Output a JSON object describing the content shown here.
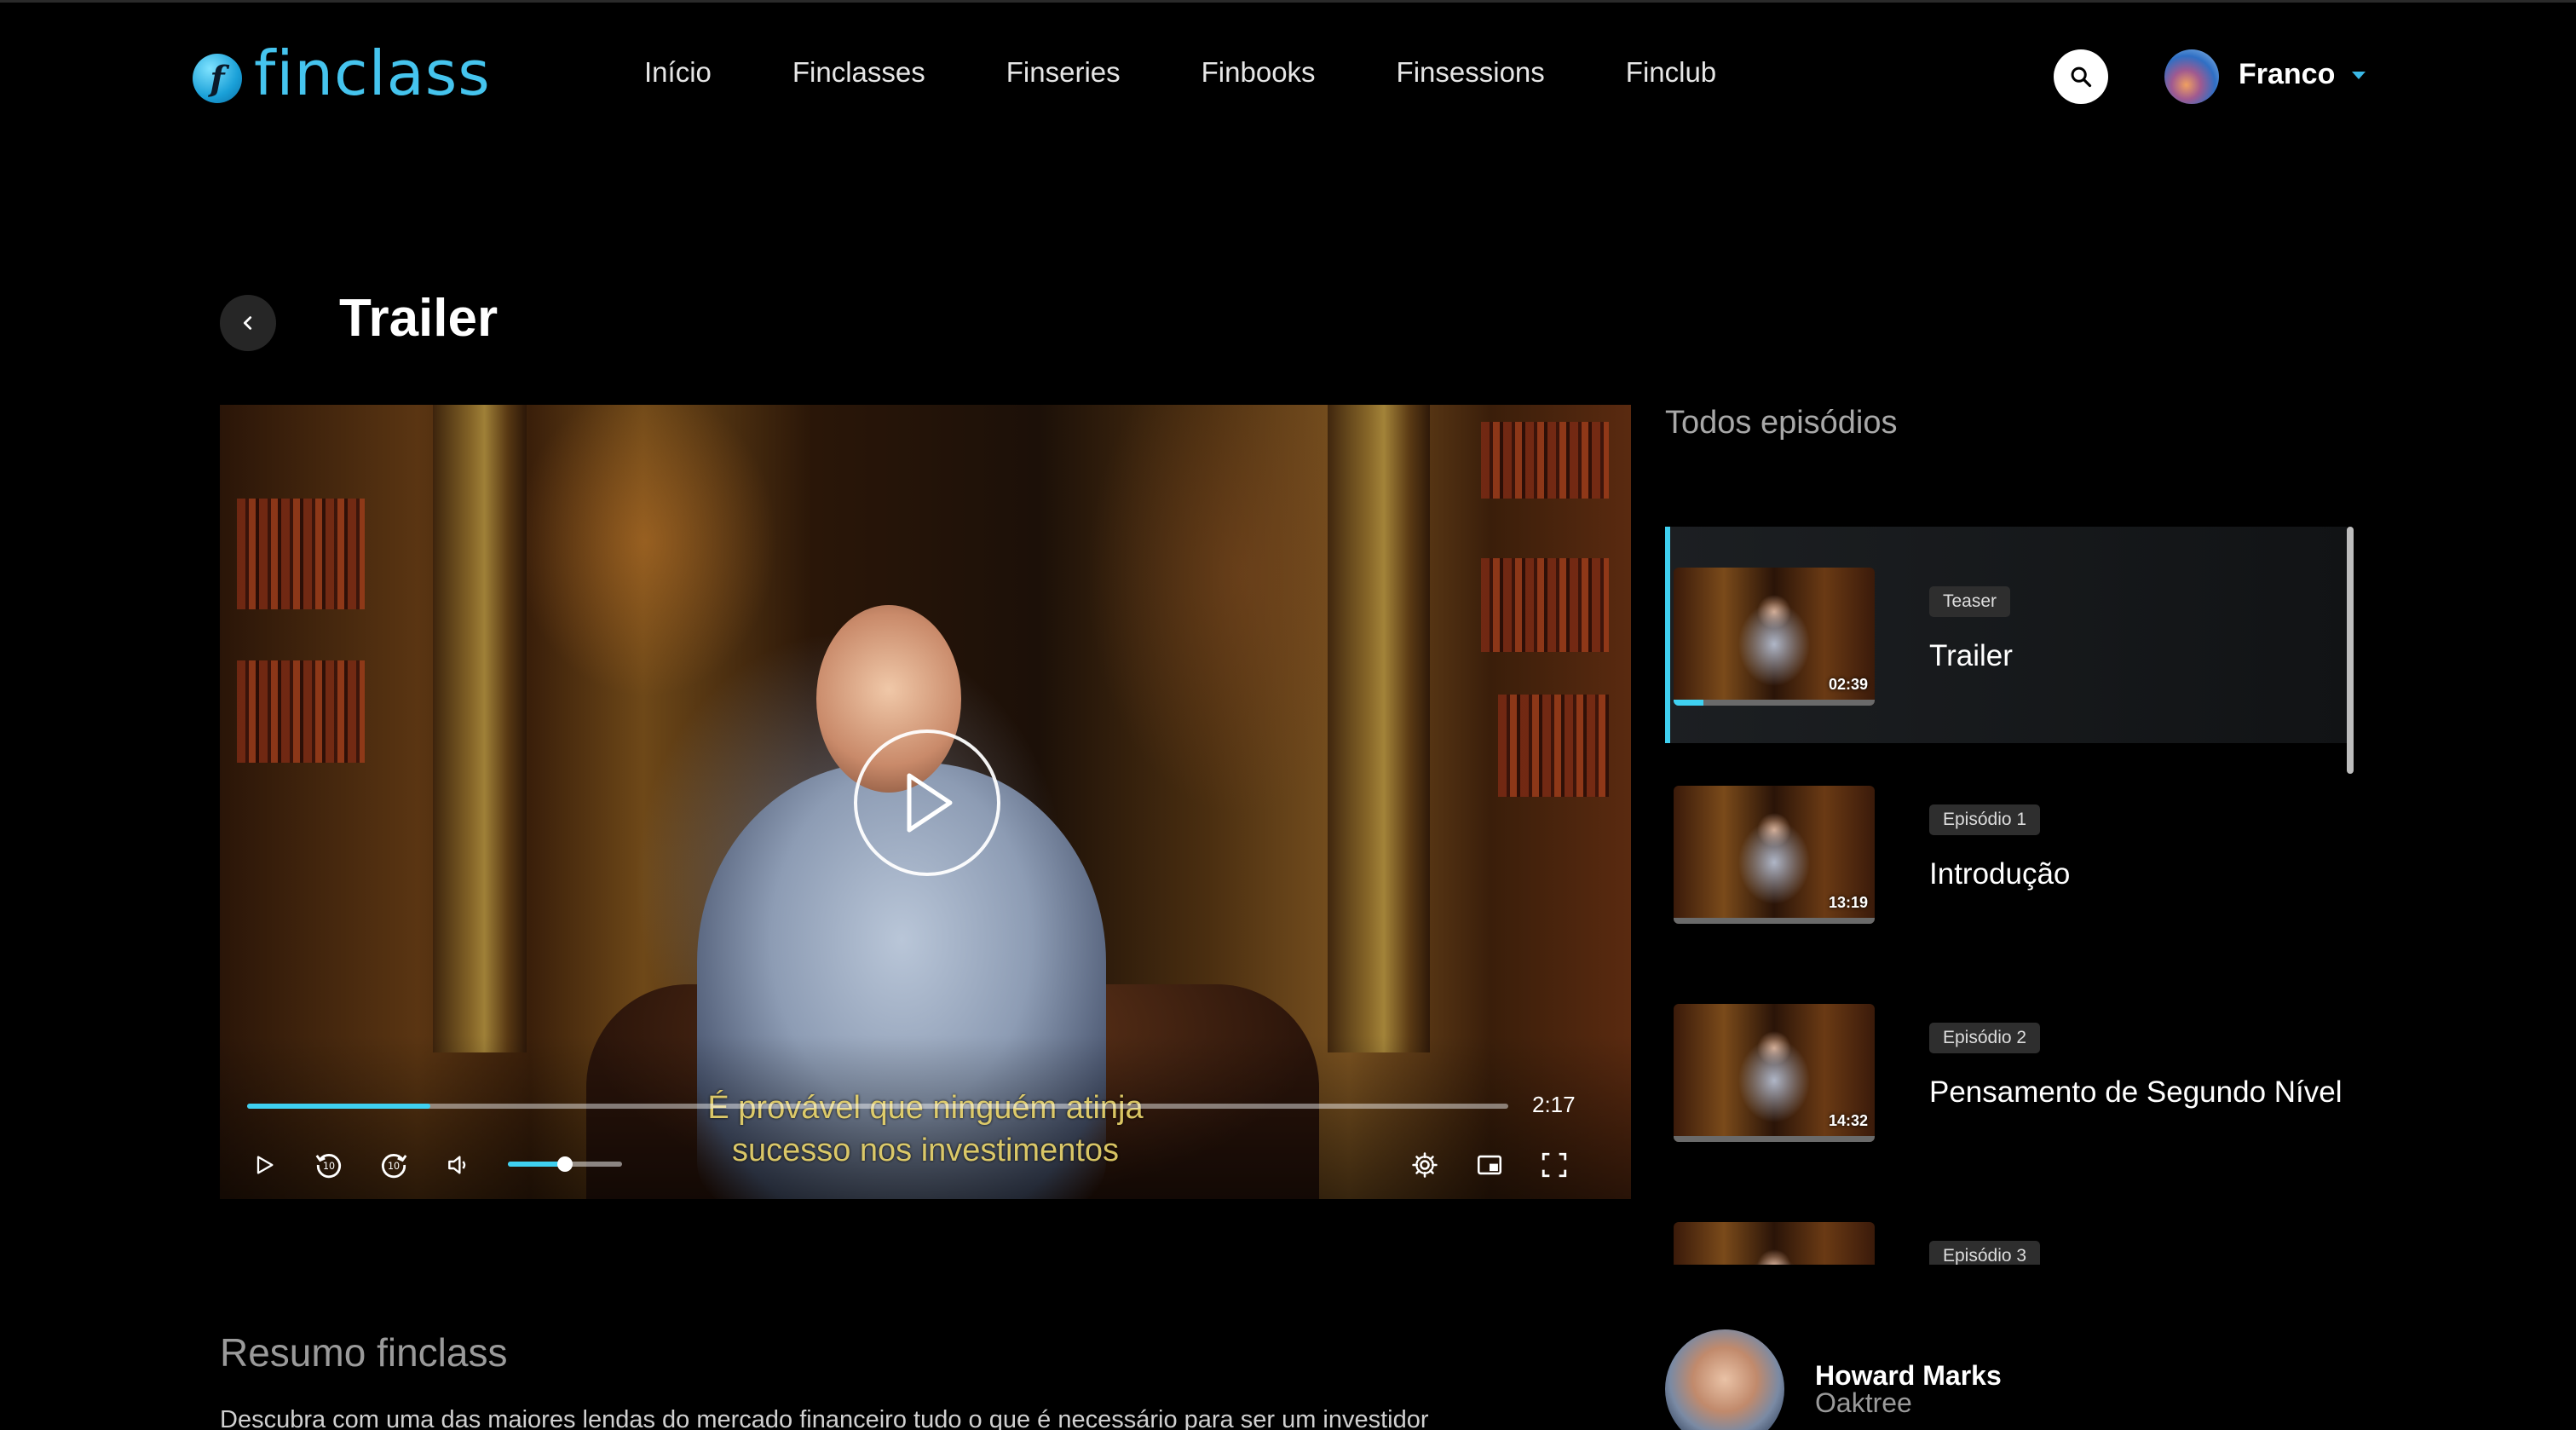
{
  "brand": {
    "logo_text": "finclass",
    "logo_glyph": "f"
  },
  "nav": {
    "items": [
      {
        "label": "Início"
      },
      {
        "label": "Finclasses"
      },
      {
        "label": "Finseries"
      },
      {
        "label": "Finbooks"
      },
      {
        "label": "Finsessions"
      },
      {
        "label": "Finclub"
      }
    ]
  },
  "header": {
    "search_icon": "search-icon",
    "user_name": "Franco"
  },
  "page": {
    "title": "Trailer"
  },
  "player": {
    "subtitle_line1": "É provável que ninguém atinja",
    "subtitle_line2": "sucesso nos investimentos",
    "time_remaining": "2:17",
    "progress_fraction": 0.145,
    "volume_fraction": 0.5,
    "accent_color": "#3fd0f0"
  },
  "episodes": {
    "heading": "Todos episódios",
    "items": [
      {
        "badge": "Teaser",
        "title": "Trailer",
        "duration": "02:39",
        "active": true,
        "watched_fraction": 0.15
      },
      {
        "badge": "Episódio 1",
        "title": "Introdução",
        "duration": "13:19",
        "active": false,
        "watched_fraction": 0
      },
      {
        "badge": "Episódio 2",
        "title": "Pensamento de Segundo Nível",
        "duration": "14:32",
        "active": false,
        "watched_fraction": 0
      },
      {
        "badge": "Episódio 3",
        "title": "",
        "duration": "",
        "active": false,
        "watched_fraction": 0
      }
    ]
  },
  "summary": {
    "heading": "Resumo finclass",
    "text": "Descubra com uma das maiores lendas do mercado financeiro tudo o que é necessário para ser um investidor"
  },
  "author": {
    "name": "Howard Marks",
    "organization": "Oaktree"
  }
}
